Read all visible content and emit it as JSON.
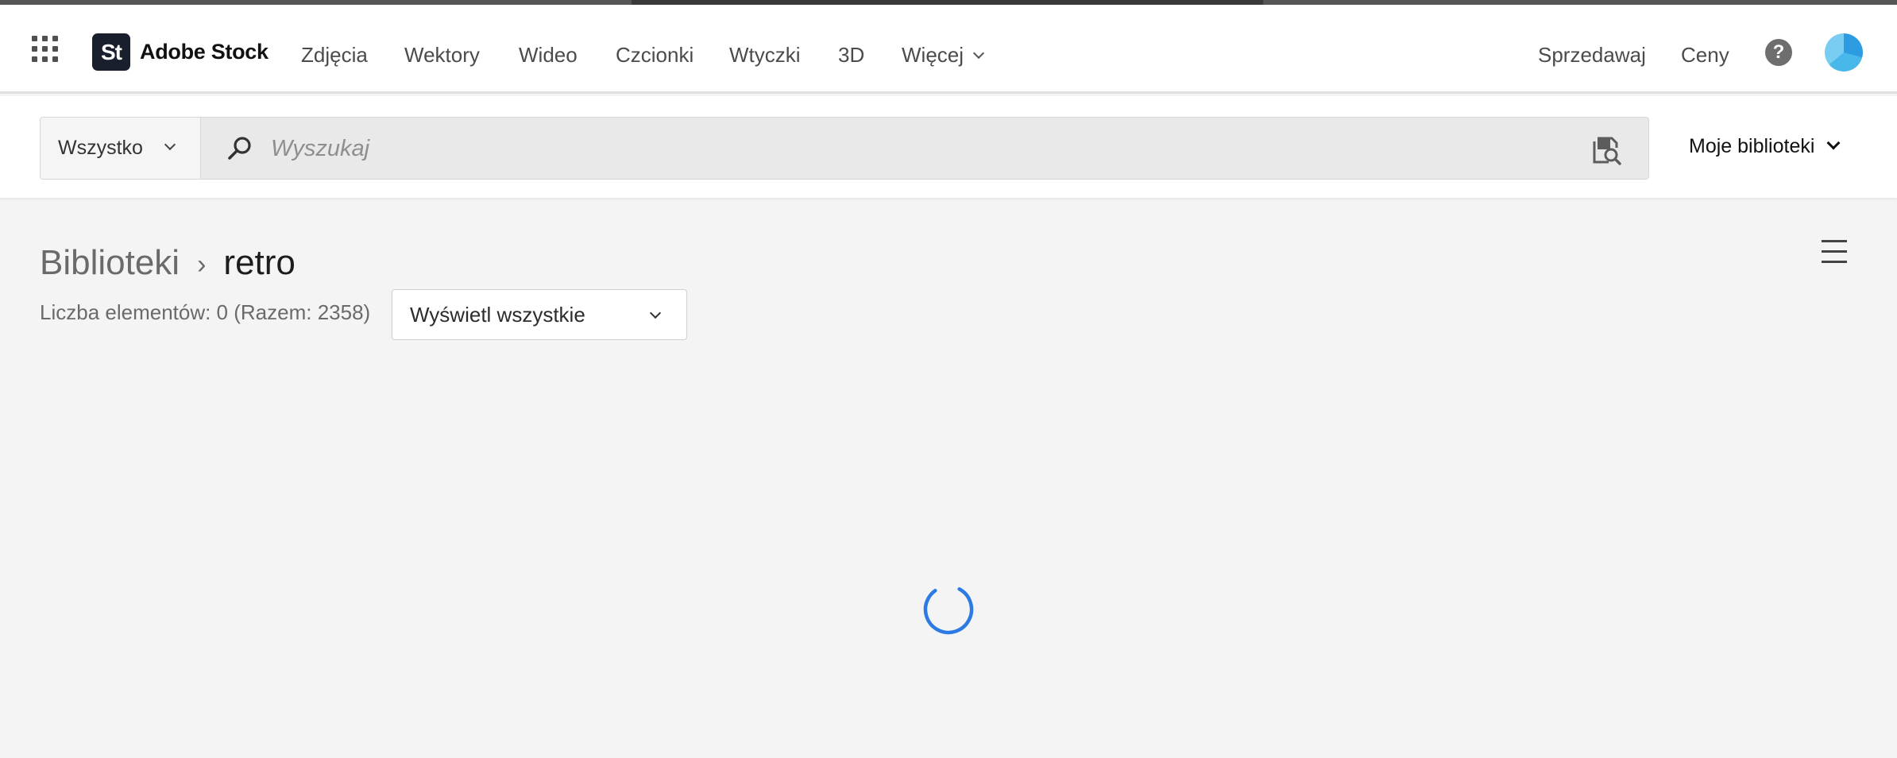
{
  "brand": {
    "badge": "St",
    "name": "Adobe Stock"
  },
  "nav": {
    "items": [
      "Zdjęcia",
      "Wektory",
      "Wideo",
      "Czcionki",
      "Wtyczki",
      "3D"
    ],
    "more": "Więcej",
    "right": [
      "Sprzedawaj",
      "Ceny"
    ],
    "help_symbol": "?"
  },
  "search": {
    "scope": "Wszystko",
    "placeholder": "Wyszukaj",
    "value": ""
  },
  "libraries_menu": "Moje biblioteki",
  "breadcrumb": {
    "parent": "Biblioteki",
    "separator": "›",
    "current": "retro"
  },
  "count_text": "Liczba elementów: 0 (Razem: 2358)",
  "filter": {
    "selected": "Wyświetl wszystkie"
  },
  "colors": {
    "accent": "#2c7be5",
    "logo_bg": "#1a1f2e",
    "page_bg": "#f4f4f4"
  },
  "icons": [
    "apps-grid-icon",
    "search-icon",
    "visual-search-icon",
    "help-icon",
    "menu-icon",
    "loading-spinner-icon"
  ]
}
